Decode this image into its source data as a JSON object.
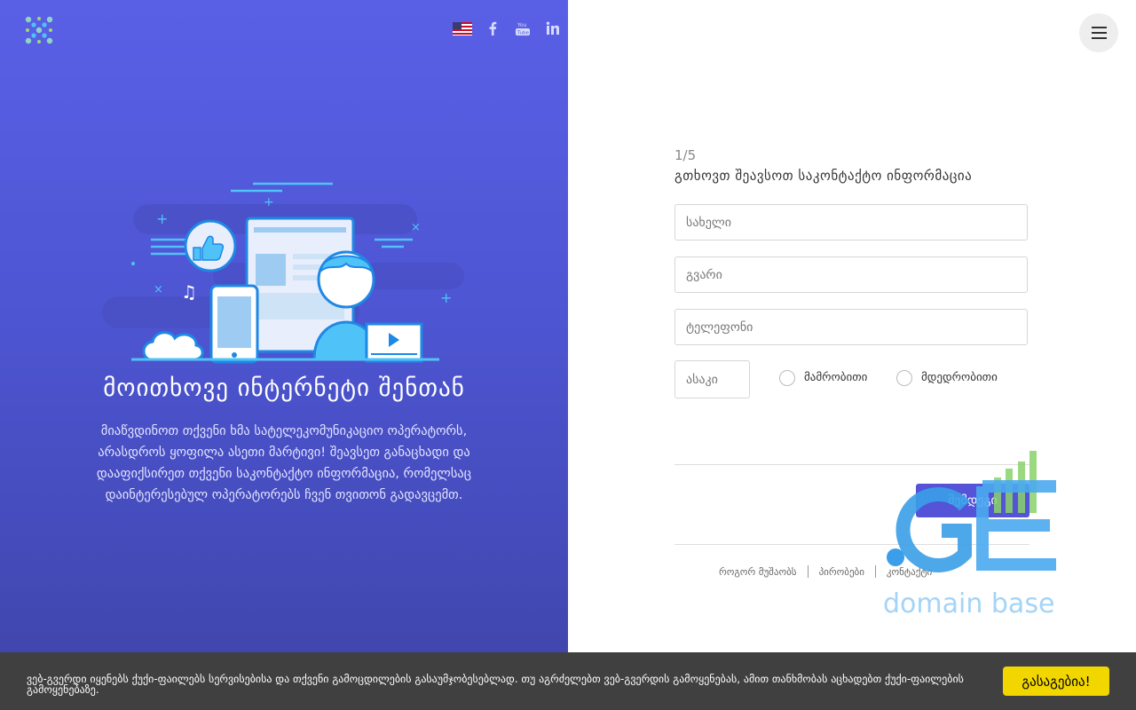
{
  "hero": {
    "title": "მოითხოვე ინტერნეტი შენთან",
    "description": "მიაწვდინოთ თქვენი ხმა სატელეკომუნიკაციო ოპერატორს, არასდროს ყოფილა ასეთი მარტივი! შეავსეთ განაცხადი და დააფიქსირეთ თქვენი საკონტაქტო ინფორმაცია, რომელსაც დაინტერესებულ ოპერატორებს ჩვენ თვითონ გადავცემთ."
  },
  "social": [
    "us-flag-icon",
    "facebook-icon",
    "youtube-icon",
    "linkedin-icon"
  ],
  "form": {
    "step": "1/5",
    "title": "გთხოვთ შეავსოთ საკონტაქტო ინფორმაცია",
    "name_placeholder": "სახელი",
    "surname_placeholder": "გვარი",
    "phone_placeholder": "ტელეფონი",
    "age_placeholder": "ასაკი",
    "gender_male": "მამრობითი",
    "gender_female": "მდედრობითი",
    "next_label": "შემდეგი"
  },
  "footer": {
    "how_it_works": "როგორ მუშაობს",
    "terms": "პირობები",
    "contact": "კონტაქტი"
  },
  "watermark": {
    "text": "domain base"
  },
  "cookie": {
    "text": "ვებ-გვერდი იყენებს ქუქი-ფაილებს სერვისებისა და თქვენი გამოცდილების გასაუმჯობესებლად. თუ აგრძელებთ ვებ-გვერდის გამოყენებას, ამით თანხმობას აცხადებთ ქუქი-ფაილების გამოყენებაზე.",
    "button": "გასაგებია!"
  },
  "colors": {
    "left_bg": "#5359e0",
    "button": "#5553d8",
    "cookie_button": "#f1d600",
    "cookie_bg": "#404040"
  }
}
